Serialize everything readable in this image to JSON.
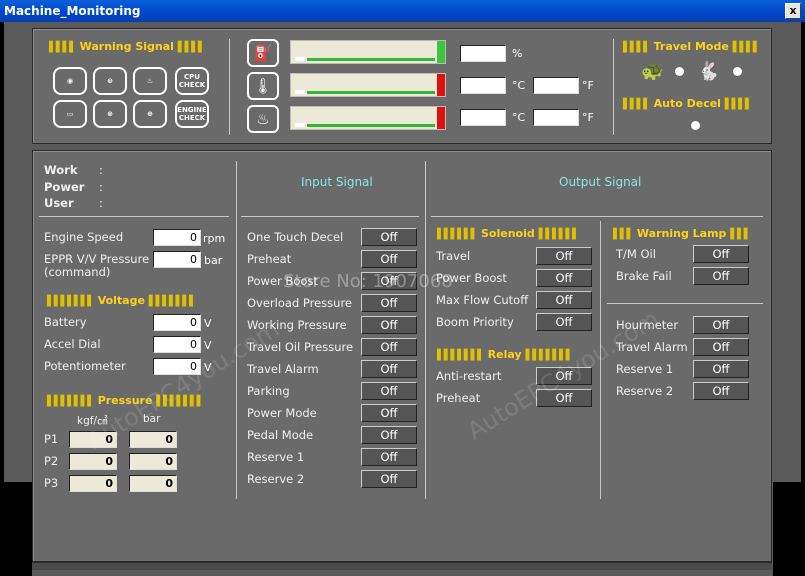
{
  "window": {
    "title": "Machine_Monitoring",
    "close": "x"
  },
  "top": {
    "warning_signal": "Warning Signal",
    "icons": {
      "cpu": "CPU CHECK",
      "engine": "ENGINE CHECK"
    },
    "gauges": [
      {
        "unit1": "%",
        "value1": ""
      },
      {
        "unit1": "°C",
        "value1": "",
        "unit2": "°F",
        "value2": ""
      },
      {
        "unit1": "°C",
        "value1": "",
        "unit2": "°F",
        "value2": ""
      }
    ],
    "travel_mode": "Travel Mode",
    "auto_decel": "Auto Decel"
  },
  "info": {
    "work": "Work",
    "power": "Power",
    "user": "User",
    "colon": ":"
  },
  "engine": {
    "speed_label": "Engine Speed",
    "speed_value": "0",
    "speed_unit": "rpm",
    "eppr_label1": "EPPR V/V Pressure",
    "eppr_label2": "(command)",
    "eppr_value": "0",
    "eppr_unit": "bar"
  },
  "voltage": {
    "title": "Voltage",
    "items": [
      {
        "label": "Battery",
        "value": "0",
        "unit": "V"
      },
      {
        "label": "Accel Dial",
        "value": "0",
        "unit": "V"
      },
      {
        "label": "Potentiometer",
        "value": "0",
        "unit": "V"
      }
    ]
  },
  "pressure": {
    "title": "Pressure",
    "unit1": "kgf/㎠",
    "unit2": "bar",
    "rows": [
      {
        "label": "P1",
        "v1": "0",
        "v2": "0"
      },
      {
        "label": "P2",
        "v1": "0",
        "v2": "0"
      },
      {
        "label": "P3",
        "v1": "0",
        "v2": "0"
      }
    ]
  },
  "input": {
    "title": "Input Signal",
    "items": [
      {
        "label": "One Touch Decel",
        "state": "Off"
      },
      {
        "label": "Preheat",
        "state": "Off"
      },
      {
        "label": "Power Boost",
        "state": "Off"
      },
      {
        "label": "Overload Pressure",
        "state": "Off"
      },
      {
        "label": "Working Pressure",
        "state": "Off"
      },
      {
        "label": "Travel Oil Pressure",
        "state": "Off"
      },
      {
        "label": "Travel Alarm",
        "state": "Off"
      },
      {
        "label": "Parking",
        "state": "Off"
      },
      {
        "label": "Power Mode",
        "state": "Off"
      },
      {
        "label": "Pedal Mode",
        "state": "Off"
      },
      {
        "label": "Reserve 1",
        "state": "Off"
      },
      {
        "label": "Reserve 2",
        "state": "Off"
      }
    ]
  },
  "output": {
    "title": "Output Signal",
    "solenoid": {
      "title": "Solenoid",
      "items": [
        {
          "label": "Travel",
          "state": "Off"
        },
        {
          "label": "Power Boost",
          "state": "Off"
        },
        {
          "label": "Max Flow Cutoff",
          "state": "Off"
        },
        {
          "label": "Boom Priority",
          "state": "Off"
        }
      ]
    },
    "relay": {
      "title": "Relay",
      "items": [
        {
          "label": "Anti-restart",
          "state": "Off"
        },
        {
          "label": "Preheat",
          "state": "Off"
        }
      ]
    },
    "warning_lamp": {
      "title": "Warning Lamp",
      "items": [
        {
          "label": "T/M Oil",
          "state": "Off"
        },
        {
          "label": "Brake Fail",
          "state": "Off"
        }
      ]
    },
    "others": [
      {
        "label": "Hourmeter",
        "state": "Off"
      },
      {
        "label": "Travel Alarm",
        "state": "Off"
      },
      {
        "label": "Reserve 1",
        "state": "Off"
      },
      {
        "label": "Reserve 2",
        "state": "Off"
      }
    ]
  },
  "watermark": {
    "store": "Store No: 1907068",
    "site": "AutoEPC4you.com"
  }
}
